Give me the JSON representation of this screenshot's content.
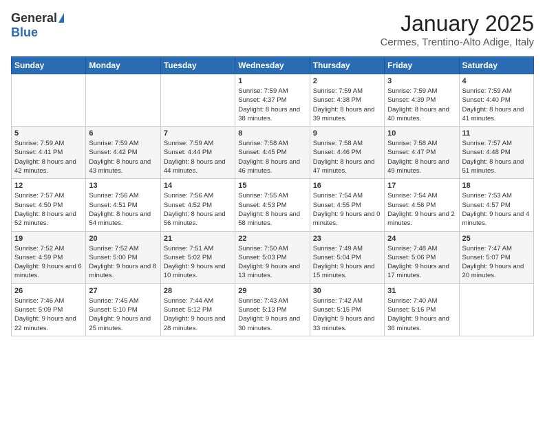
{
  "header": {
    "logo_general": "General",
    "logo_blue": "Blue",
    "title": "January 2025",
    "location": "Cermes, Trentino-Alto Adige, Italy"
  },
  "weekdays": [
    "Sunday",
    "Monday",
    "Tuesday",
    "Wednesday",
    "Thursday",
    "Friday",
    "Saturday"
  ],
  "weeks": [
    [
      {
        "day": "",
        "info": ""
      },
      {
        "day": "",
        "info": ""
      },
      {
        "day": "",
        "info": ""
      },
      {
        "day": "1",
        "info": "Sunrise: 7:59 AM\nSunset: 4:37 PM\nDaylight: 8 hours and 38 minutes."
      },
      {
        "day": "2",
        "info": "Sunrise: 7:59 AM\nSunset: 4:38 PM\nDaylight: 8 hours and 39 minutes."
      },
      {
        "day": "3",
        "info": "Sunrise: 7:59 AM\nSunset: 4:39 PM\nDaylight: 8 hours and 40 minutes."
      },
      {
        "day": "4",
        "info": "Sunrise: 7:59 AM\nSunset: 4:40 PM\nDaylight: 8 hours and 41 minutes."
      }
    ],
    [
      {
        "day": "5",
        "info": "Sunrise: 7:59 AM\nSunset: 4:41 PM\nDaylight: 8 hours and 42 minutes."
      },
      {
        "day": "6",
        "info": "Sunrise: 7:59 AM\nSunset: 4:42 PM\nDaylight: 8 hours and 43 minutes."
      },
      {
        "day": "7",
        "info": "Sunrise: 7:59 AM\nSunset: 4:44 PM\nDaylight: 8 hours and 44 minutes."
      },
      {
        "day": "8",
        "info": "Sunrise: 7:58 AM\nSunset: 4:45 PM\nDaylight: 8 hours and 46 minutes."
      },
      {
        "day": "9",
        "info": "Sunrise: 7:58 AM\nSunset: 4:46 PM\nDaylight: 8 hours and 47 minutes."
      },
      {
        "day": "10",
        "info": "Sunrise: 7:58 AM\nSunset: 4:47 PM\nDaylight: 8 hours and 49 minutes."
      },
      {
        "day": "11",
        "info": "Sunrise: 7:57 AM\nSunset: 4:48 PM\nDaylight: 8 hours and 51 minutes."
      }
    ],
    [
      {
        "day": "12",
        "info": "Sunrise: 7:57 AM\nSunset: 4:50 PM\nDaylight: 8 hours and 52 minutes."
      },
      {
        "day": "13",
        "info": "Sunrise: 7:56 AM\nSunset: 4:51 PM\nDaylight: 8 hours and 54 minutes."
      },
      {
        "day": "14",
        "info": "Sunrise: 7:56 AM\nSunset: 4:52 PM\nDaylight: 8 hours and 56 minutes."
      },
      {
        "day": "15",
        "info": "Sunrise: 7:55 AM\nSunset: 4:53 PM\nDaylight: 8 hours and 58 minutes."
      },
      {
        "day": "16",
        "info": "Sunrise: 7:54 AM\nSunset: 4:55 PM\nDaylight: 9 hours and 0 minutes."
      },
      {
        "day": "17",
        "info": "Sunrise: 7:54 AM\nSunset: 4:56 PM\nDaylight: 9 hours and 2 minutes."
      },
      {
        "day": "18",
        "info": "Sunrise: 7:53 AM\nSunset: 4:57 PM\nDaylight: 9 hours and 4 minutes."
      }
    ],
    [
      {
        "day": "19",
        "info": "Sunrise: 7:52 AM\nSunset: 4:59 PM\nDaylight: 9 hours and 6 minutes."
      },
      {
        "day": "20",
        "info": "Sunrise: 7:52 AM\nSunset: 5:00 PM\nDaylight: 9 hours and 8 minutes."
      },
      {
        "day": "21",
        "info": "Sunrise: 7:51 AM\nSunset: 5:02 PM\nDaylight: 9 hours and 10 minutes."
      },
      {
        "day": "22",
        "info": "Sunrise: 7:50 AM\nSunset: 5:03 PM\nDaylight: 9 hours and 13 minutes."
      },
      {
        "day": "23",
        "info": "Sunrise: 7:49 AM\nSunset: 5:04 PM\nDaylight: 9 hours and 15 minutes."
      },
      {
        "day": "24",
        "info": "Sunrise: 7:48 AM\nSunset: 5:06 PM\nDaylight: 9 hours and 17 minutes."
      },
      {
        "day": "25",
        "info": "Sunrise: 7:47 AM\nSunset: 5:07 PM\nDaylight: 9 hours and 20 minutes."
      }
    ],
    [
      {
        "day": "26",
        "info": "Sunrise: 7:46 AM\nSunset: 5:09 PM\nDaylight: 9 hours and 22 minutes."
      },
      {
        "day": "27",
        "info": "Sunrise: 7:45 AM\nSunset: 5:10 PM\nDaylight: 9 hours and 25 minutes."
      },
      {
        "day": "28",
        "info": "Sunrise: 7:44 AM\nSunset: 5:12 PM\nDaylight: 9 hours and 28 minutes."
      },
      {
        "day": "29",
        "info": "Sunrise: 7:43 AM\nSunset: 5:13 PM\nDaylight: 9 hours and 30 minutes."
      },
      {
        "day": "30",
        "info": "Sunrise: 7:42 AM\nSunset: 5:15 PM\nDaylight: 9 hours and 33 minutes."
      },
      {
        "day": "31",
        "info": "Sunrise: 7:40 AM\nSunset: 5:16 PM\nDaylight: 9 hours and 36 minutes."
      },
      {
        "day": "",
        "info": ""
      }
    ]
  ]
}
